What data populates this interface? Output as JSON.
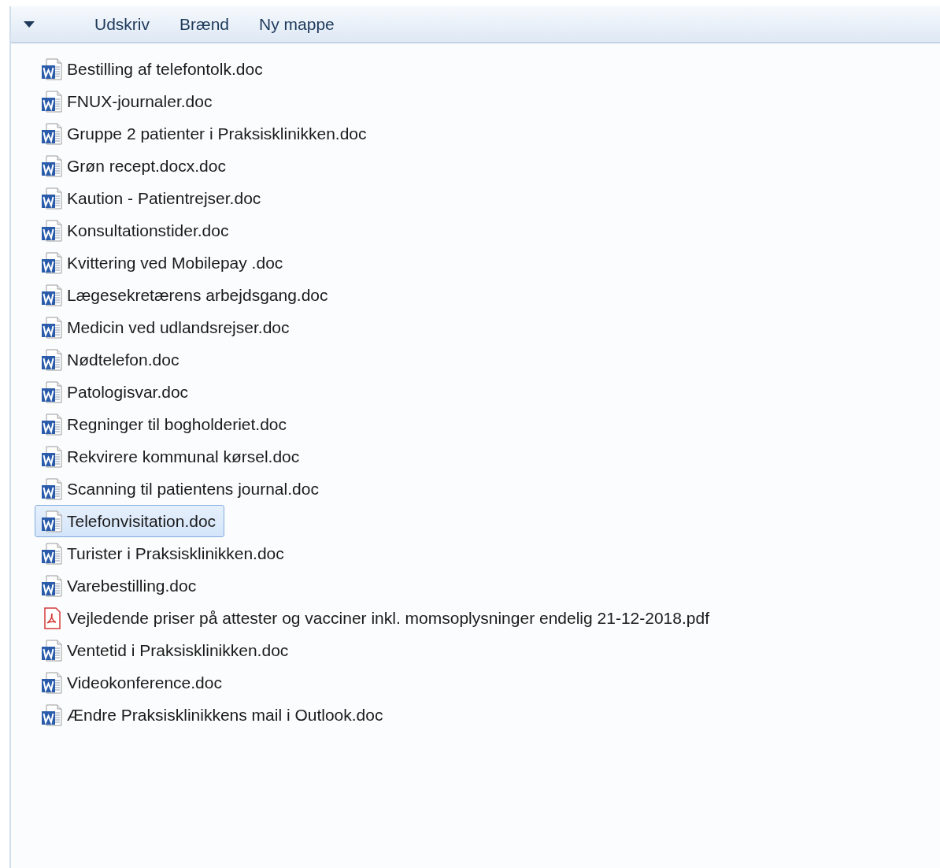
{
  "toolbar": {
    "buttons": [
      "Udskriv",
      "Brænd",
      "Ny mappe"
    ]
  },
  "files": [
    {
      "name": "Bestilling af telefontolk.doc",
      "kind": "word",
      "selected": false
    },
    {
      "name": "FNUX-journaler.doc",
      "kind": "word",
      "selected": false
    },
    {
      "name": "Gruppe 2 patienter i Praksisklinikken.doc",
      "kind": "word",
      "selected": false
    },
    {
      "name": "Grøn recept.docx.doc",
      "kind": "word",
      "selected": false
    },
    {
      "name": "Kaution - Patientrejser.doc",
      "kind": "word",
      "selected": false
    },
    {
      "name": "Konsultationstider.doc",
      "kind": "word",
      "selected": false
    },
    {
      "name": "Kvittering ved Mobilepay .doc",
      "kind": "word",
      "selected": false
    },
    {
      "name": "Lægesekretærens arbejdsgang.doc",
      "kind": "word",
      "selected": false
    },
    {
      "name": "Medicin ved udlandsrejser.doc",
      "kind": "word",
      "selected": false
    },
    {
      "name": "Nødtelefon.doc",
      "kind": "word",
      "selected": false
    },
    {
      "name": "Patologisvar.doc",
      "kind": "word",
      "selected": false
    },
    {
      "name": "Regninger til bogholderiet.doc",
      "kind": "word",
      "selected": false
    },
    {
      "name": "Rekvirere kommunal kørsel.doc",
      "kind": "word",
      "selected": false
    },
    {
      "name": "Scanning til patientens journal.doc",
      "kind": "word",
      "selected": false
    },
    {
      "name": "Telefonvisitation.doc",
      "kind": "word",
      "selected": true
    },
    {
      "name": "Turister i Praksisklinikken.doc",
      "kind": "word",
      "selected": false
    },
    {
      "name": "Varebestilling.doc",
      "kind": "word",
      "selected": false
    },
    {
      "name": "Vejledende priser på attester og vacciner inkl. momsoplysninger endelig 21-12-2018.pdf",
      "kind": "pdf",
      "selected": false
    },
    {
      "name": "Ventetid i Praksisklinikken.doc",
      "kind": "word",
      "selected": false
    },
    {
      "name": "Videokonference.doc",
      "kind": "word",
      "selected": false
    },
    {
      "name": "Ændre Praksisklinikkens mail i Outlook.doc",
      "kind": "word",
      "selected": false
    }
  ]
}
